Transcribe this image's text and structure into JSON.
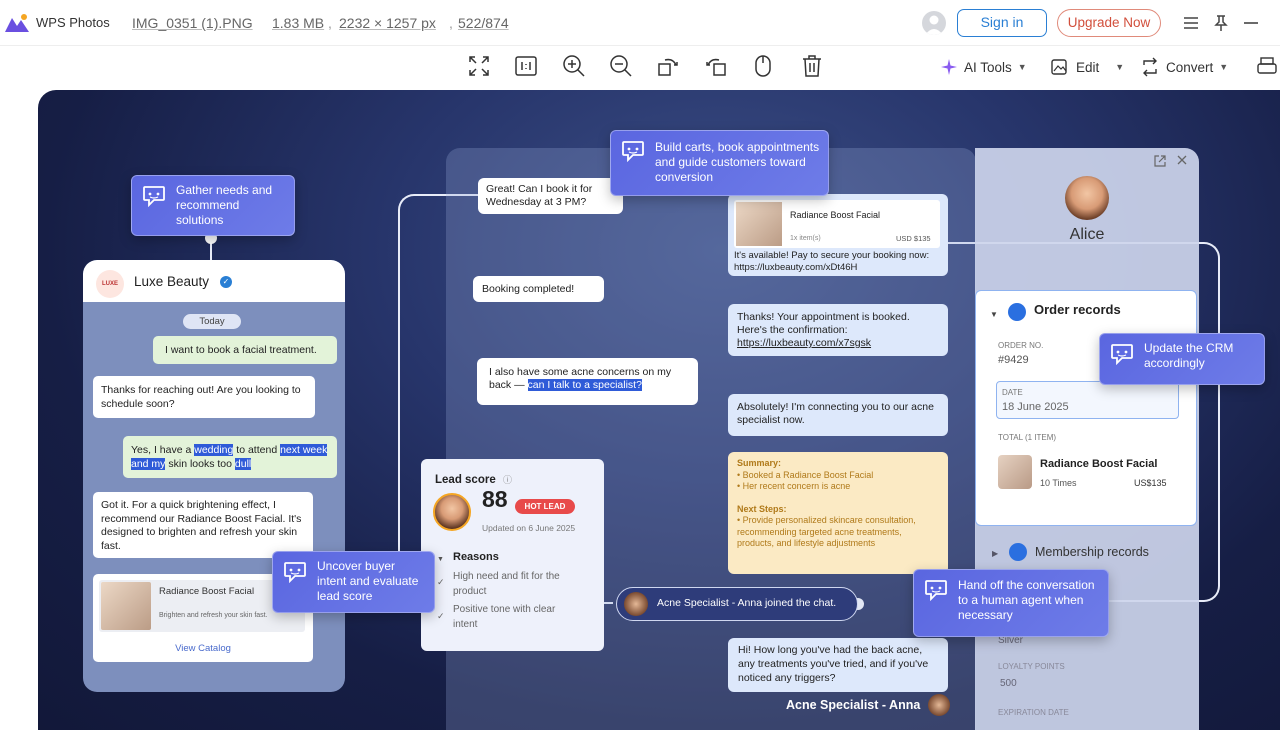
{
  "titlebar": {
    "app_name": "WPS Photos",
    "file_name": "IMG_0351 (1).PNG",
    "file_size": "1.83 MB",
    "dimensions": "2232 × 1257 px",
    "position": "522/874",
    "sign_in": "Sign in",
    "upgrade": "Upgrade Now"
  },
  "toolbar": {
    "tools": [
      "fullscreen-icon",
      "actual-size-icon",
      "zoom-in-icon",
      "zoom-out-icon",
      "rotate-left-icon",
      "rotate-right-icon",
      "mouse-icon",
      "delete-icon"
    ],
    "ai_tools": "AI Tools",
    "edit": "Edit",
    "convert": "Convert"
  },
  "image": {
    "chat": {
      "brand": "Luxe Beauty",
      "brand_logo": "LUXE",
      "date_chip": "Today",
      "msg1": "I want to book a facial treatment.",
      "msg2": "Thanks for reaching out! Are you looking to schedule soon?",
      "msg3a": "Yes, I have a ",
      "msg3b": "wedding",
      "msg3c": " to attend ",
      "msg3d": "next week",
      "msg3e": "and my",
      "msg3f": " skin looks too ",
      "msg3g": "dull",
      "msg4": "Got it. For a quick brightening effect, I recommend our Radiance Boost Facial. It's designed to brighten and refresh your skin fast.",
      "product_name": "Radiance Boost Facial",
      "product_desc": "Brighten and refresh your skin fast.",
      "view_catalog": "View Catalog"
    },
    "features": {
      "gather": "Gather needs and recommend solutions",
      "build": "Build carts, book appointments and guide customers toward conversion",
      "crm": "Update the CRM accordingly",
      "intent": "Uncover buyer intent and evaluate lead score",
      "handoff": "Hand off the conversation to a human agent when necessary"
    },
    "middle": {
      "q1": "Great! Can I book it for Wednesday at 3 PM?",
      "booking_done": "Booking completed!",
      "acne_q_a": "I also have some acne concerns on my back — ",
      "acne_q_b": "can I talk to a specialist?",
      "prod_name": "Radiance Boost Facial",
      "prod_qty": "1x item(s)",
      "prod_price": "USD $135",
      "pay_msg": "It's available! Pay to secure your booking now:",
      "pay_link": "https://luxbeauty.com/xDt46H",
      "confirm_msg": "Thanks! Your appointment is booked. Here's the confirmation:",
      "confirm_link": "https://luxbeauty.com/x7sgsk",
      "connect_msg": "Absolutely! I'm connecting you to our acne specialist now.",
      "summary_title": "Summary:",
      "summary_1": "Booked a Radiance Boost Facial",
      "summary_2": "Her recent concern is acne",
      "next_title": "Next Steps:",
      "next_1": "Provide personalized skincare consultation, recommending targeted acne treatments, products, and lifestyle adjustments",
      "joined": "Acne Specialist - Anna joined the chat.",
      "anna_msg": "Hi! How long you've had the back acne, any treatments you've tried, and if you've noticed any triggers?",
      "anna_sig": "Acne Specialist - Anna"
    },
    "lead": {
      "title": "Lead score",
      "score": "88",
      "tag": "HOT LEAD",
      "updated": "Updated on 6 June 2025",
      "reasons": "Reasons",
      "reason1": "High need and fit for the product",
      "reason2": "Positive tone with clear intent"
    },
    "crm": {
      "name": "Alice",
      "order_records": "Order records",
      "order_no_label": "ORDER NO.",
      "order_no": "#9429",
      "date_label": "DATE",
      "date": "18 June 2025",
      "total_label": "TOTAL (1 ITEM)",
      "item_name": "Radiance Boost Facial",
      "item_qty": "10 Times",
      "item_price": "US$135",
      "membership": "Membership records",
      "tier": "Silver",
      "loyalty_label": "LOYALTY POINTS",
      "loyalty": "500",
      "expiry_label": "EXPIRATION DATE"
    }
  },
  "colors": {
    "accent": "#2a7fd4",
    "upgrade": "#d24f3c",
    "feature": "#5a66e0",
    "hot": "#e84a4a"
  }
}
